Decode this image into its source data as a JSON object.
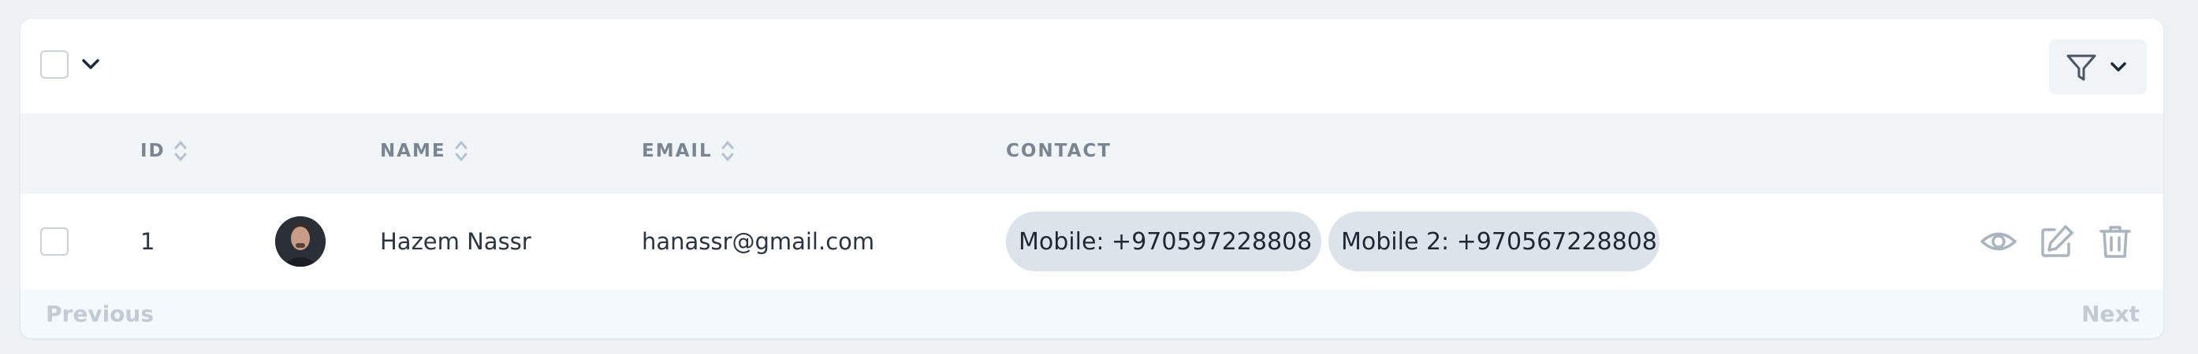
{
  "toolbar": {
    "select_all_checked": false,
    "icons": {
      "select_dropdown": "chevron-down-icon",
      "filter": "filter-icon"
    }
  },
  "table": {
    "columns": {
      "id": "ID",
      "name": "NAME",
      "email": "EMAIL",
      "contact": "CONTACT"
    },
    "rows": [
      {
        "id": "1",
        "name": "Hazem Nassr",
        "email": "hanassr@gmail.com",
        "contacts": [
          "Mobile: +970597228808",
          "Mobile 2: +970567228808"
        ],
        "actions": [
          "eye-icon",
          "edit-icon",
          "trash-icon"
        ]
      }
    ]
  },
  "pagination": {
    "previous": "Previous",
    "next": "Next"
  },
  "colors": {
    "page_bg": "#eef1f4",
    "header_bg": "#f1f5f8",
    "pill_bg": "#dde3ea",
    "footer_bg": "#f4f9fd"
  }
}
